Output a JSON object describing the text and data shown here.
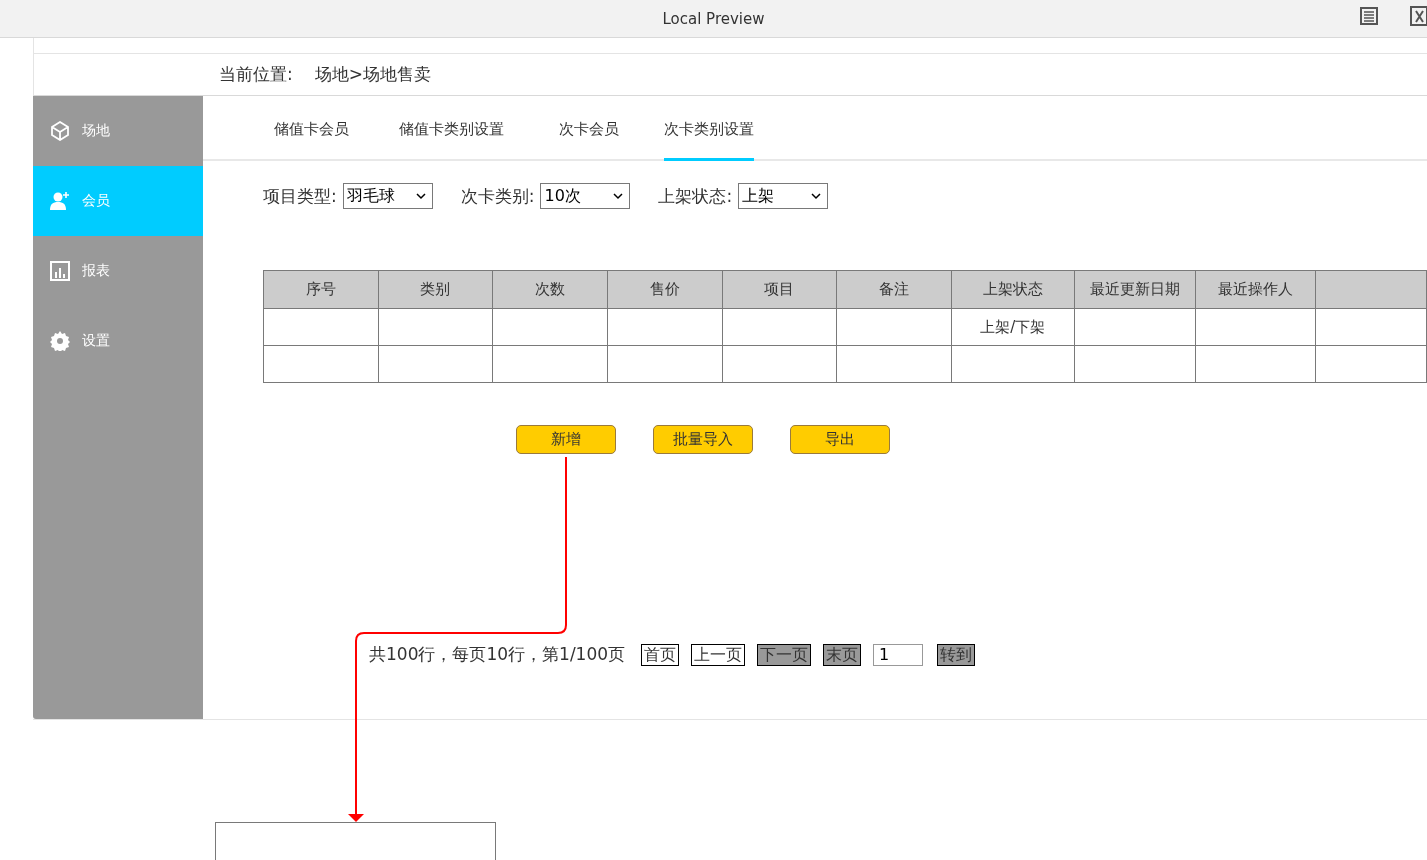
{
  "window": {
    "title": "Local Preview"
  },
  "breadcrumb": {
    "label": "当前位置:",
    "path": "场地>场地售卖"
  },
  "sidebar": {
    "items": [
      {
        "label": "场地",
        "selected": false
      },
      {
        "label": "会员",
        "selected": true
      },
      {
        "label": "报表",
        "selected": false
      },
      {
        "label": "设置",
        "selected": false
      }
    ]
  },
  "tabs": [
    {
      "label": "储值卡会员",
      "selected": false
    },
    {
      "label": "储值卡类别设置",
      "selected": false
    },
    {
      "label": "次卡会员",
      "selected": false
    },
    {
      "label": "次卡类别设置",
      "selected": true
    }
  ],
  "filters": [
    {
      "label": "项目类型:",
      "value": "羽毛球"
    },
    {
      "label": "次卡类别:",
      "value": "10次"
    },
    {
      "label": "上架状态:",
      "value": "上架"
    }
  ],
  "table": {
    "columns": [
      "序号",
      "类别",
      "次数",
      "售价",
      "项目",
      "备注",
      "上架状态",
      "最近更新日期",
      "最近操作人"
    ],
    "rows": [
      {
        "shelf_status": "上架/下架"
      },
      {
        "shelf_status": null
      }
    ]
  },
  "actions": [
    "新增",
    "批量导入",
    "导出"
  ],
  "pager": {
    "summary": "共100行，每页10行，第1/100页",
    "buttons": [
      {
        "label": "首页",
        "kind": "plain"
      },
      {
        "label": "上一页",
        "kind": "plain"
      },
      {
        "label": "下一页",
        "kind": "shaded"
      },
      {
        "label": "末页",
        "kind": "shaded"
      }
    ],
    "page_input": "1",
    "go": {
      "label": "转到",
      "kind": "shaded"
    }
  }
}
